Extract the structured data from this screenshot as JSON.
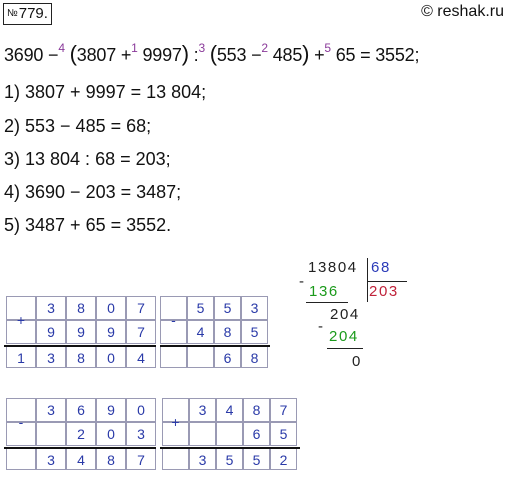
{
  "header": {
    "number_sign": "№",
    "task_number": "779.",
    "copyright": "© reshak.ru"
  },
  "expression": {
    "t1": "3690 −",
    "o4": "4",
    "t2": "(",
    "t3": "3807 +",
    "o1": "1",
    "t4": " 9997",
    "t5": ")",
    "t6": " :",
    "o3": "3",
    "t7": "(",
    "t8": "553 −",
    "o2": "2",
    "t9": " 485",
    "t10": ")",
    "t11": " +",
    "o5": "5",
    "t12": " 65 = 3552;"
  },
  "steps": [
    "1) 3807 + 9997 = 13 804;",
    "2) 553 − 485 = 68;",
    "3) 13 804 : 68 = 203;",
    "4) 3690 − 203 = 3487;",
    "5) 3487 + 65 = 3552."
  ],
  "columns": {
    "add1": {
      "sign": "+",
      "row1": [
        "",
        "3",
        "8",
        "0",
        "7"
      ],
      "row2": [
        "",
        "9",
        "9",
        "9",
        "7"
      ],
      "result": [
        "1",
        "3",
        "8",
        "0",
        "4"
      ]
    },
    "sub1": {
      "sign": "-",
      "row1": [
        "",
        "5",
        "5",
        "3"
      ],
      "row2": [
        "",
        "4",
        "8",
        "5"
      ],
      "result": [
        "",
        "",
        "6",
        "8"
      ]
    },
    "sub2": {
      "sign": "-",
      "row1": [
        "",
        "3",
        "6",
        "9",
        "0"
      ],
      "row2": [
        "",
        "",
        "2",
        "0",
        "3"
      ],
      "result": [
        "",
        "3",
        "4",
        "8",
        "7"
      ]
    },
    "add2": {
      "sign": "+",
      "row1": [
        "",
        "3",
        "4",
        "8",
        "7"
      ],
      "row2": [
        "",
        "",
        "",
        "6",
        "5"
      ],
      "result": [
        "",
        "3",
        "5",
        "5",
        "2"
      ]
    }
  },
  "long_division": {
    "dividend": "13804",
    "divisor": "68",
    "quotient": "203",
    "minus1": "-",
    "sub1": "136",
    "rem1": "204",
    "minus2": "-",
    "sub2": "204",
    "remainder": "0"
  }
}
